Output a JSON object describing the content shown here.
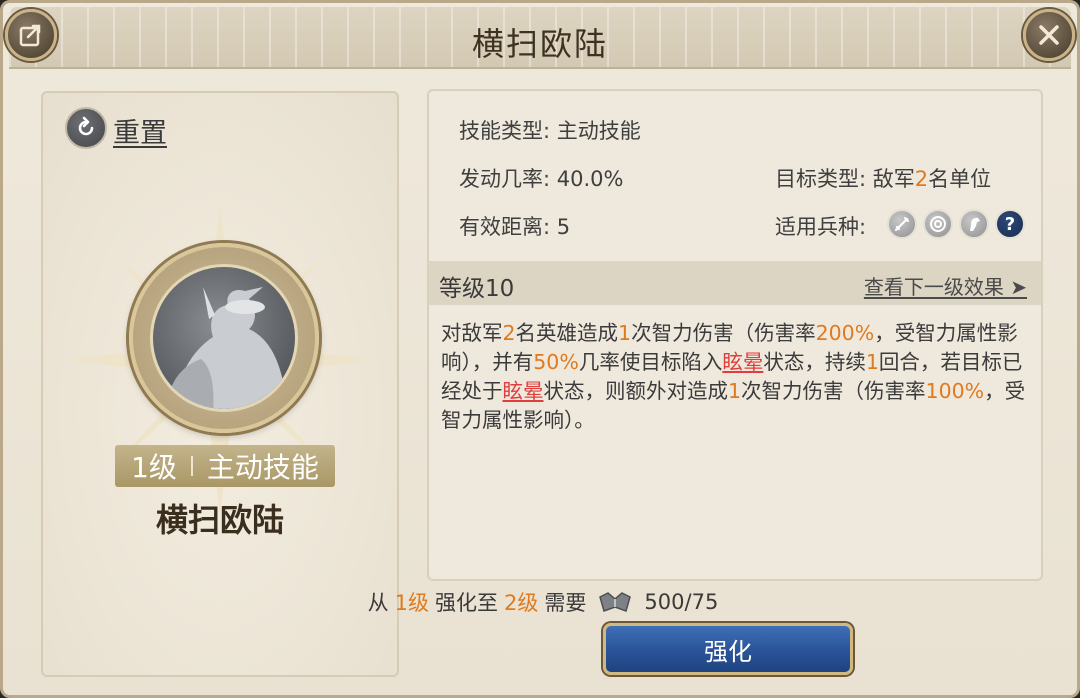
{
  "header": {
    "title": "横扫欧陆",
    "share_icon": "share-icon",
    "close_icon": "close-icon"
  },
  "left": {
    "reset_label": "重置",
    "level_text": "1级",
    "skill_type_tag": "主动技能",
    "skill_name": "横扫欧陆"
  },
  "info": {
    "skill_type_label": "技能类型:",
    "skill_type_value": "主动技能",
    "trigger_label": "发动几率:",
    "trigger_value": "40.0%",
    "range_label": "有效距离:",
    "range_value": "5",
    "target_label": "目标类型:",
    "target_pre": "敌军",
    "target_num": "2",
    "target_post": "名单位",
    "troop_label": "适用兵种:",
    "troop_icons": [
      "sword-icon",
      "target-icon",
      "horse-icon",
      "help-icon"
    ],
    "help_glyph": "?"
  },
  "level": {
    "title": "等级10",
    "next_link": "查看下一级效果 ➤"
  },
  "description": {
    "p1": "对敌军",
    "n1": "2",
    "p2": "名英雄造成",
    "n2": "1",
    "p3": "次智力伤害（伤害率",
    "n3": "200%",
    "p4": "，受智力属性影响），并有",
    "n4": "50%",
    "p5": "几率使目标陷入",
    "s1": "眩晕",
    "p6": "状态，持续",
    "n5": "1",
    "p7": "回合，若目标已经处于",
    "s2": "眩晕",
    "p8": "状态，则额外对造成",
    "n6": "1",
    "p9": "次智力伤害（伤害率",
    "n7": "100%",
    "p10": "，受智力属性影响）。"
  },
  "cost": {
    "from": "从",
    "from_level": "1级",
    "upgrade_to": "强化至",
    "to_level": "2级",
    "need": "需要",
    "amount": "500/75"
  },
  "upgrade_button": "强化",
  "colors": {
    "highlight": "#e07a1e",
    "status_red": "#e03e3e",
    "button_blue": "#2a5398"
  }
}
